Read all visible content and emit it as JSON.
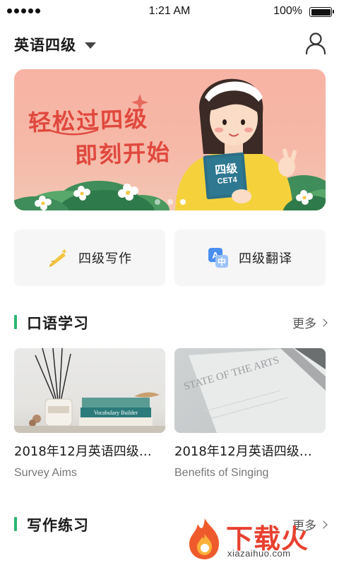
{
  "status_bar": {
    "time": "1:21 AM",
    "battery": "100%"
  },
  "header": {
    "title": "英语四级"
  },
  "banner": {
    "line1": "轻松过四级",
    "line2": "即刻开始",
    "book_line1": "四级",
    "book_line2": "CET4"
  },
  "quick_actions": [
    {
      "label": "四级写作",
      "icon": "pencil-sparkle-icon"
    },
    {
      "label": "四级翻译",
      "icon": "translate-icon"
    }
  ],
  "oral": {
    "title": "口语学习",
    "more": "更多",
    "cards": [
      {
        "title": "2018年12月英语四级…",
        "subtitle": "Survey Aims",
        "book_text": "Vocabulary Builder"
      },
      {
        "title": "2018年12月英语四级…",
        "subtitle": "Benefits of Singing",
        "magazine_text": "STATE OF THE ARTS"
      }
    ]
  },
  "writing": {
    "title": "写作练习",
    "more": "更多"
  },
  "watermark": {
    "brand": "下载火",
    "url": "xiazaihuo.com"
  },
  "colors": {
    "accent_green": "#2bb673",
    "banner_red": "#e0483d",
    "brand_orange": "#e8412f"
  }
}
